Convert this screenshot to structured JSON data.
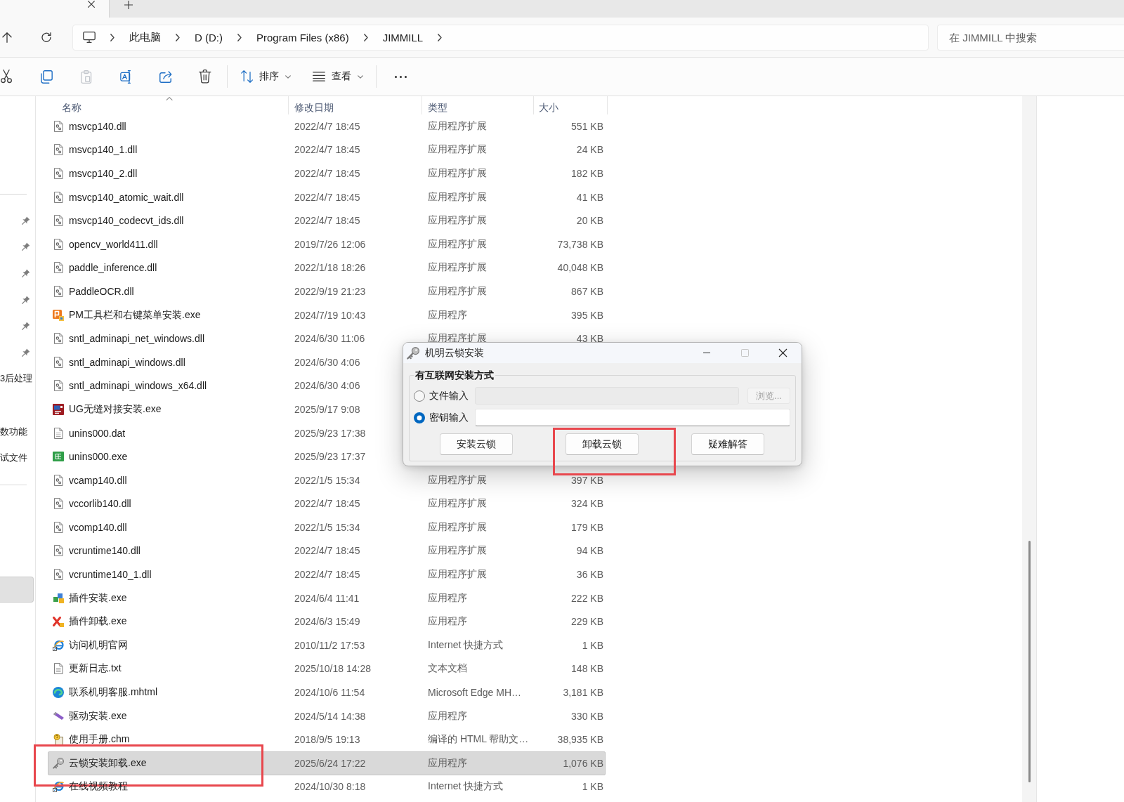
{
  "tabs": [
    {
      "selected": true
    }
  ],
  "navigation": [
    {
      "kind": "up"
    },
    {
      "kind": "refresh"
    }
  ],
  "address_bar": {
    "crumbs": [
      "此电脑",
      "D (D:)",
      "Program Files (x86)",
      "JIMMILL"
    ]
  },
  "search": {
    "placeholder": "在 JIMMILL 中搜索"
  },
  "toolbar": {
    "actions": [
      {
        "kind": "cut",
        "disabled": false
      },
      {
        "kind": "copy",
        "disabled": false
      },
      {
        "kind": "paste",
        "disabled": true
      },
      {
        "kind": "rename",
        "disabled": false
      },
      {
        "kind": "share",
        "disabled": false
      },
      {
        "kind": "delete",
        "disabled": false
      }
    ],
    "sort": {
      "label": "排序"
    },
    "view": {
      "label": "查看"
    }
  },
  "sidebar": {
    "quick_access": [
      {
        "pinned": true,
        "selected": false
      },
      {
        "pinned": true,
        "selected": false
      },
      {
        "pinned": true,
        "selected": false
      },
      {
        "pinned": true,
        "selected": false
      },
      {
        "pinned": true,
        "selected": false
      },
      {
        "pinned": true,
        "selected": false
      },
      {
        "label": "3后处理",
        "pinned": false,
        "selected": false
      },
      {
        "pinned": false,
        "selected": false
      },
      {
        "label": "数功能",
        "pinned": false,
        "selected": false
      },
      {
        "label": "试文件",
        "pinned": false,
        "selected": false
      }
    ],
    "locations": [
      {
        "selected": false
      },
      {
        "selected": false
      },
      {
        "selected": false
      },
      {
        "selected": true
      }
    ]
  },
  "file_list": {
    "columns": [
      {
        "label": "名称",
        "sorted": true
      },
      {
        "label": "修改日期",
        "sorted": false
      },
      {
        "label": "类型",
        "sorted": false
      },
      {
        "label": "大小",
        "sorted": false
      }
    ],
    "rows": [
      {
        "kind": "library",
        "name": "msvcp140.dll",
        "date": "2022/4/7 18:45",
        "type": "应用程序扩展",
        "size": "551 KB",
        "selected": false,
        "highlighted": false
      },
      {
        "kind": "library",
        "name": "msvcp140_1.dll",
        "date": "2022/4/7 18:45",
        "type": "应用程序扩展",
        "size": "24 KB",
        "selected": false,
        "highlighted": false
      },
      {
        "kind": "library",
        "name": "msvcp140_2.dll",
        "date": "2022/4/7 18:45",
        "type": "应用程序扩展",
        "size": "182 KB",
        "selected": false,
        "highlighted": false
      },
      {
        "kind": "library",
        "name": "msvcp140_atomic_wait.dll",
        "date": "2022/4/7 18:45",
        "type": "应用程序扩展",
        "size": "41 KB",
        "selected": false,
        "highlighted": false
      },
      {
        "kind": "library",
        "name": "msvcp140_codecvt_ids.dll",
        "date": "2022/4/7 18:45",
        "type": "应用程序扩展",
        "size": "20 KB",
        "selected": false,
        "highlighted": false
      },
      {
        "kind": "library",
        "name": "opencv_world411.dll",
        "date": "2019/7/26 12:06",
        "type": "应用程序扩展",
        "size": "73,738 KB",
        "selected": false,
        "highlighted": false
      },
      {
        "kind": "library",
        "name": "paddle_inference.dll",
        "date": "2022/1/18 18:26",
        "type": "应用程序扩展",
        "size": "40,048 KB",
        "selected": false,
        "highlighted": false
      },
      {
        "kind": "library",
        "name": "PaddleOCR.dll",
        "date": "2022/9/19 21:23",
        "type": "应用程序扩展",
        "size": "867 KB",
        "selected": false,
        "highlighted": false
      },
      {
        "kind": "package",
        "name": "PM工具栏和右键菜单安装.exe",
        "date": "2024/7/19 10:43",
        "type": "应用程序",
        "size": "395 KB",
        "selected": false,
        "highlighted": false
      },
      {
        "kind": "library",
        "name": "sntl_adminapi_net_windows.dll",
        "date": "2024/6/30 11:06",
        "type": "应用程序扩展",
        "size": "43 KB",
        "selected": false,
        "highlighted": false
      },
      {
        "kind": "library",
        "name": "sntl_adminapi_windows.dll",
        "date": "2024/6/30 4:06",
        "selected": false,
        "highlighted": false
      },
      {
        "kind": "library",
        "name": "sntl_adminapi_windows_x64.dll",
        "date": "2024/6/30 4:06",
        "selected": false,
        "highlighted": false
      },
      {
        "kind": "nx",
        "name": "UG无缝对接安装.exe",
        "date": "2025/9/17 9:08",
        "selected": false,
        "highlighted": false
      },
      {
        "kind": "document",
        "name": "unins000.dat",
        "date": "2025/9/23 17:38",
        "selected": false,
        "highlighted": false
      },
      {
        "kind": "setup",
        "name": "unins000.exe",
        "date": "2025/9/23 17:37",
        "selected": false,
        "highlighted": false
      },
      {
        "kind": "library",
        "name": "vcamp140.dll",
        "date": "2022/1/5 15:34",
        "type": "应用程序扩展",
        "size": "397 KB",
        "selected": false,
        "highlighted": false
      },
      {
        "kind": "library",
        "name": "vccorlib140.dll",
        "date": "2022/4/7 18:45",
        "type": "应用程序扩展",
        "size": "324 KB",
        "selected": false,
        "highlighted": false
      },
      {
        "kind": "library",
        "name": "vcomp140.dll",
        "date": "2022/1/5 15:34",
        "type": "应用程序扩展",
        "size": "179 KB",
        "selected": false,
        "highlighted": false
      },
      {
        "kind": "library",
        "name": "vcruntime140.dll",
        "date": "2022/4/7 18:45",
        "type": "应用程序扩展",
        "size": "94 KB",
        "selected": false,
        "highlighted": false
      },
      {
        "kind": "library",
        "name": "vcruntime140_1.dll",
        "date": "2022/4/7 18:45",
        "type": "应用程序扩展",
        "size": "36 KB",
        "selected": false,
        "highlighted": false
      },
      {
        "kind": "plugin",
        "name": "插件安装.exe",
        "date": "2024/6/4 11:41",
        "type": "应用程序",
        "size": "222 KB",
        "selected": false,
        "highlighted": false
      },
      {
        "kind": "remove",
        "name": "插件卸载.exe",
        "date": "2024/6/3 15:49",
        "type": "应用程序",
        "size": "229 KB",
        "selected": false,
        "highlighted": false
      },
      {
        "kind": "link",
        "name": "访问机明官网",
        "date": "2010/11/2 17:53",
        "type": "Internet 快捷方式",
        "size": "1 KB",
        "selected": false,
        "highlighted": false
      },
      {
        "kind": "document",
        "name": "更新日志.txt",
        "date": "2025/10/18 14:28",
        "type": "文本文档",
        "size": "148 KB",
        "selected": false,
        "highlighted": false
      },
      {
        "kind": "edge",
        "name": "联系机明客服.mhtml",
        "date": "2024/10/6 11:54",
        "type": "Microsoft Edge MH…",
        "size": "3,181 KB",
        "selected": false,
        "highlighted": false
      },
      {
        "kind": "driver",
        "name": "驱动安装.exe",
        "date": "2024/5/14 14:38",
        "type": "应用程序",
        "size": "330 KB",
        "selected": false,
        "highlighted": false
      },
      {
        "kind": "help",
        "name": "使用手册.chm",
        "date": "2018/9/5 19:13",
        "type": "编译的 HTML 帮助文…",
        "size": "38,935 KB",
        "selected": false,
        "highlighted": false
      },
      {
        "kind": "key",
        "name": "云锁安装卸载.exe",
        "date": "2025/6/24 17:22",
        "type": "应用程序",
        "size": "1,076 KB",
        "selected": true,
        "highlighted": true
      },
      {
        "kind": "link",
        "name": "在线视频教程",
        "date": "2024/10/30 8:18",
        "type": "Internet 快捷方式",
        "size": "1 KB",
        "selected": false,
        "highlighted": false
      }
    ]
  },
  "dialog": {
    "title": "机明云锁安装",
    "controls": [
      {
        "kind": "minimize",
        "disabled": false
      },
      {
        "kind": "maximize",
        "disabled": true
      },
      {
        "kind": "close",
        "disabled": false
      }
    ],
    "group": {
      "label": "有互联网安装方式",
      "options": [
        {
          "kind": "file",
          "label": "文件输入",
          "selected": false,
          "field": {
            "disabled": true
          },
          "browse": {
            "label": "浏览...",
            "disabled": true
          }
        },
        {
          "kind": "key",
          "label": "密钥输入",
          "selected": true,
          "field": {
            "disabled": false
          }
        }
      ]
    },
    "buttons": [
      {
        "label": "安装云锁",
        "highlighted": false
      },
      {
        "label": "卸载云锁",
        "highlighted": true
      },
      {
        "label": "疑难解答",
        "highlighted": false
      }
    ]
  }
}
